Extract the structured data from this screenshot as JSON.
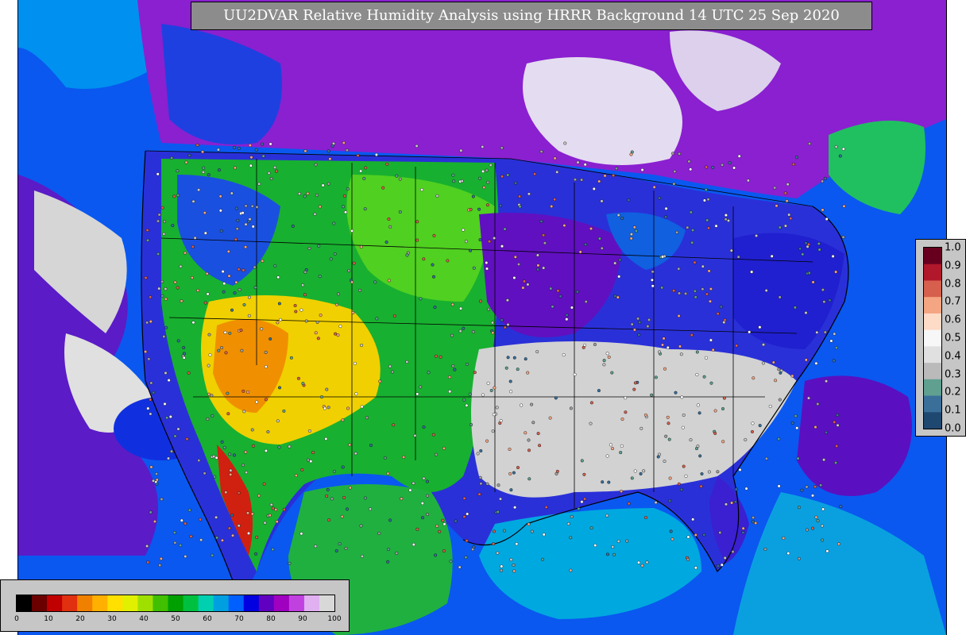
{
  "title": "UU2DVAR Relative Humidity Analysis using HRRR Background 14 UTC 25 Sep 2020",
  "rh_legend": {
    "ticks": [
      "0",
      "10",
      "20",
      "30",
      "40",
      "50",
      "60",
      "70",
      "80",
      "90",
      "100"
    ],
    "colors": [
      "#000000",
      "#6a0000",
      "#c00000",
      "#e03010",
      "#f08000",
      "#ffb000",
      "#ffe000",
      "#e0f000",
      "#a0e000",
      "#40c000",
      "#00a000",
      "#00c040",
      "#00d0b0",
      "#00a0e0",
      "#0060ff",
      "#0000e0",
      "#6000c0",
      "#a000c0",
      "#c040e0",
      "#e0b0f0",
      "#d8d8d8"
    ]
  },
  "fraction_legend": {
    "ticks": [
      "1.0",
      "0.9",
      "0.8",
      "0.7",
      "0.6",
      "0.5",
      "0.4",
      "0.3",
      "0.2",
      "0.1",
      "0.0"
    ],
    "colors": [
      "#67001f",
      "#b2182b",
      "#d6604d",
      "#f4a582",
      "#fddbc7",
      "#f7f7f7",
      "#e0e0e0",
      "#bababa",
      "#5fa090",
      "#3a6f9a",
      "#1f4870"
    ]
  },
  "map": {
    "regions": [
      {
        "name": "rh-ocean-pacific",
        "color": "#0a64ff"
      },
      {
        "name": "rh-ocean-atlantic",
        "color": "#0060f0"
      },
      {
        "name": "rh-gulf",
        "color": "#00a0e0"
      },
      {
        "name": "rh-west-green",
        "color": "#20c020"
      },
      {
        "name": "rh-plains-green",
        "color": "#30c030"
      },
      {
        "name": "rh-southwest-yellow",
        "color": "#f0c000"
      },
      {
        "name": "rh-east-blue",
        "color": "#2020d0"
      },
      {
        "name": "rh-southeast-white",
        "color": "#d4d4d4"
      },
      {
        "name": "rh-canada-purple",
        "color": "#a000c0"
      }
    ]
  }
}
